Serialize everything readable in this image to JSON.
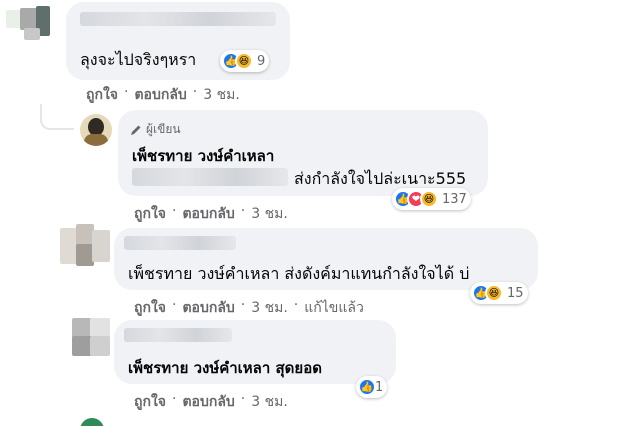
{
  "comments": [
    {
      "text": "ลุงจะไปจริงๆหรา",
      "reaction_count": "9",
      "actions": {
        "like": "ถูกใจ",
        "reply": "ตอบกลับ",
        "time": "3 ชม."
      }
    },
    {
      "badge": "ผู้เขียน",
      "name": "เพ็ชรทาย วงษ์คำเหลา",
      "text": "ส่งกำลังใจไปล่ะเนาะ555",
      "reaction_count": "137",
      "actions": {
        "like": "ถูกใจ",
        "reply": "ตอบกลับ",
        "time": "3 ชม."
      }
    },
    {
      "text": "เพ็ชรทาย วงษ์คำเหลา ส่งดังค์มาแทนกำลังใจได้ บ่",
      "reaction_count": "15",
      "actions": {
        "like": "ถูกใจ",
        "reply": "ตอบกลับ",
        "time": "3 ชม.",
        "edited": "แก้ไขแล้ว"
      }
    },
    {
      "text": "เพ็ชรทาย วงษ์คำเหลา สุดยอด",
      "reaction_count": "1",
      "actions": {
        "like": "ถูกใจ",
        "reply": "ตอบกลับ",
        "time": "3 ชม."
      }
    }
  ],
  "separator": "·",
  "colors": {
    "like": "#1877f2",
    "haha": "#f7b928",
    "love": "#f33e58",
    "bubble": "#f0f2f5",
    "meta": "#65676b"
  },
  "icons": [
    "like-icon",
    "haha-icon",
    "love-icon",
    "pencil-icon"
  ]
}
